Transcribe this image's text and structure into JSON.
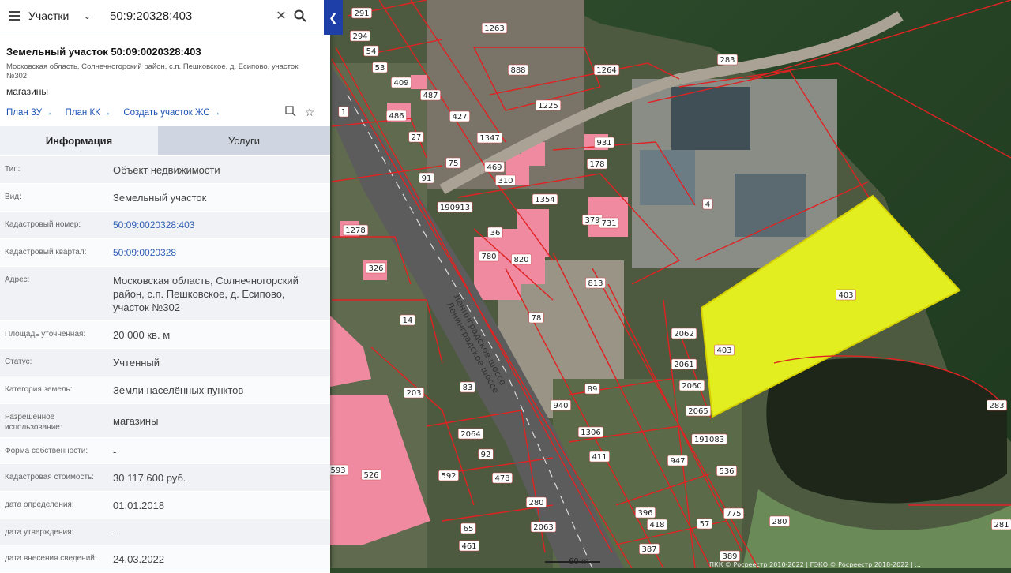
{
  "search": {
    "layer": "Участки",
    "query": "50:9:20328:403"
  },
  "object": {
    "title": "Земельный участок 50:09:0020328:403",
    "address": "Московская область, Солнечногорский район, с.п. Пешковское, д. Есипово, участок №302",
    "use": "магазины"
  },
  "links": [
    {
      "label": "План ЗУ"
    },
    {
      "label": "План КК"
    },
    {
      "label": "Создать участок ЖС"
    }
  ],
  "tabs": [
    {
      "label": "Информация"
    },
    {
      "label": "Услуги"
    }
  ],
  "info_rows": [
    {
      "label": "Тип:",
      "value": "Объект недвижимости"
    },
    {
      "label": "Вид:",
      "value": "Земельный участок"
    },
    {
      "label": "Кадастровый номер:",
      "value": "50:09:0020328:403"
    },
    {
      "label": "Кадастровый квартал:",
      "value": "50:09:0020328"
    },
    {
      "label": "Адрес:",
      "value": "Московская область, Солнечногорский район, с.п. Пешковское, д. Есипово, участок №302"
    },
    {
      "label": "Площадь уточненная:",
      "value": "20 000 кв. м"
    },
    {
      "label": "Статус:",
      "value": "Учтенный"
    },
    {
      "label": "Категория земель:",
      "value": "Земли населённых пунктов"
    },
    {
      "label": "Разрешенное использование:",
      "value": "магазины"
    },
    {
      "label": "Форма собственности:",
      "value": "-"
    },
    {
      "label": "Кадастровая стоимость:",
      "value": "30 117 600 руб."
    },
    {
      "label": "дата определения:",
      "value": "01.01.2018"
    },
    {
      "label": "дата утверждения:",
      "value": "-"
    },
    {
      "label": "дата внесения сведений:",
      "value": "24.03.2022"
    }
  ],
  "map": {
    "road_name": "Ленинградское шоссе",
    "scale_label": "60 m",
    "copyright": "ПКК © Росреестр 2010-2022 | ГЭКО © Росреестр 2018-2022 | ...",
    "plot_labels": [
      "291",
      "294",
      "1263",
      "54",
      "53",
      "888",
      "409",
      "487",
      "1264",
      "283",
      "1225",
      "486",
      "427",
      "27",
      "1347",
      "1",
      "75",
      "91",
      "469",
      "310",
      "178",
      "931",
      "190913",
      "1354",
      "379",
      "731",
      "1278",
      "36",
      "780",
      "820",
      "526",
      "4",
      "326",
      "14",
      "813",
      "78",
      "403",
      "403",
      "2062",
      "2061",
      "2060",
      "2065",
      "203",
      "83",
      "940",
      "89",
      "1306",
      "191083",
      "2064",
      "411",
      "947",
      "92",
      "593",
      "478",
      "592",
      "536",
      "2063",
      "775",
      "280",
      "280",
      "396",
      "418",
      "57",
      "65",
      "387",
      "461",
      "389",
      "283",
      "281"
    ],
    "colors": {
      "selected_fill": "#e2ee1f",
      "boundary": "#e02222",
      "building": "#f08aa0"
    }
  }
}
